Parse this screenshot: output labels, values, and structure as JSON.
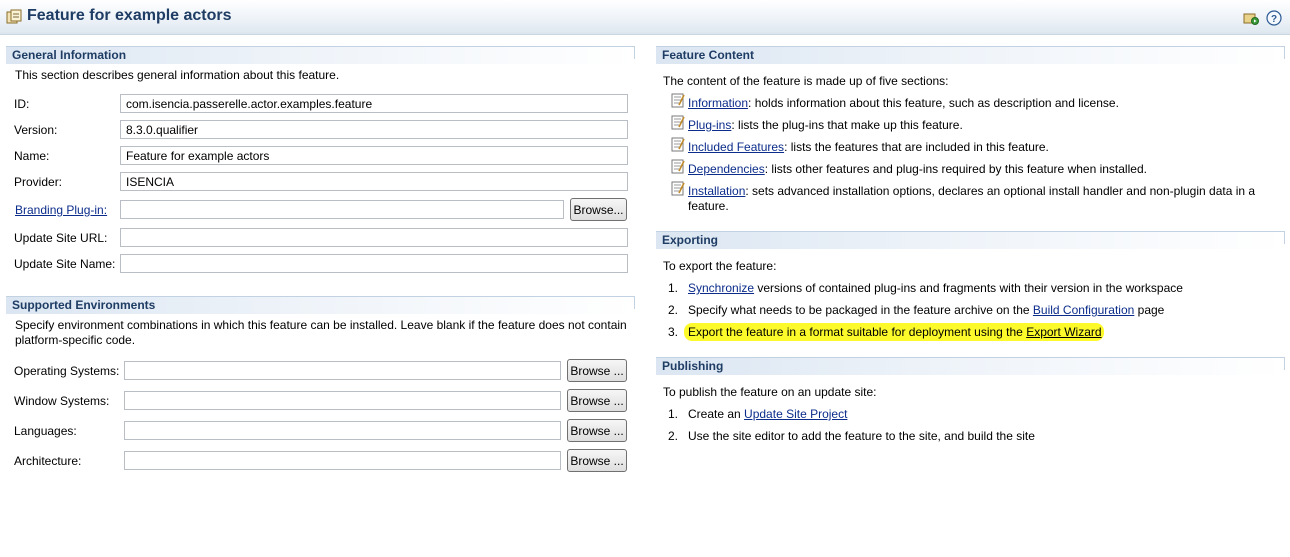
{
  "header": {
    "title": "Feature for example actors"
  },
  "general": {
    "title": "General Information",
    "description": "This section describes general information about this feature.",
    "id_label": "ID:",
    "id_value": "com.isencia.passerelle.actor.examples.feature",
    "version_label": "Version:",
    "version_value": "8.3.0.qualifier",
    "name_label": "Name:",
    "name_value": "Feature for example actors",
    "provider_label": "Provider:",
    "provider_value": "ISENCIA",
    "branding_label": "Branding Plug-in:",
    "branding_value": "",
    "update_url_label": "Update Site URL:",
    "update_url_value": "",
    "update_name_label": "Update Site Name:",
    "update_name_value": "",
    "browse_label": "Browse..."
  },
  "environments": {
    "title": "Supported Environments",
    "description": "Specify environment combinations in which this feature can be installed. Leave blank if the feature does not contain platform-specific code.",
    "os_label": "Operating Systems:",
    "ws_label": "Window Systems:",
    "lang_label": "Languages:",
    "arch_label": "Architecture:",
    "browse_label": "Browse ..."
  },
  "content": {
    "title": "Feature Content",
    "intro": "The content of the feature is made up of five sections:",
    "items": [
      {
        "link": "Information",
        "text": ": holds information about this feature, such as description and license."
      },
      {
        "link": "Plug-ins",
        "text": ": lists the plug-ins that make up this feature."
      },
      {
        "link": "Included Features",
        "text": ": lists the features that are included in this feature."
      },
      {
        "link": "Dependencies",
        "text": ": lists other features and plug-ins required by this feature when installed."
      },
      {
        "link": "Installation",
        "text": ": sets advanced installation options, declares an optional install handler and non-plugin data in a feature."
      }
    ]
  },
  "exporting": {
    "title": "Exporting",
    "intro": "To export the feature:",
    "step1_num": "1.",
    "step1_link": "Synchronize",
    "step1_text": " versions of contained plug-ins and fragments with their version in the workspace",
    "step2_num": "2.",
    "step2_text": "Specify what needs to be packaged in the feature archive on the ",
    "step2_link": "Build Configuration",
    "step2_tail": " page",
    "step3_num": "3.",
    "step3_text": "Export the feature in a format suitable for deployment using the ",
    "step3_link": "Export Wizard",
    "highlight_color": "#fdfa2b"
  },
  "publishing": {
    "title": "Publishing",
    "intro": "To publish the feature on an update site:",
    "step1_num": "1.",
    "step1_text": "Create an ",
    "step1_link": "Update Site Project",
    "step2_num": "2.",
    "step2_text": "Use the site editor to add the feature to the site, and build the site"
  },
  "colors": {
    "title": "#1e3c64",
    "link": "#0b2c8a"
  }
}
